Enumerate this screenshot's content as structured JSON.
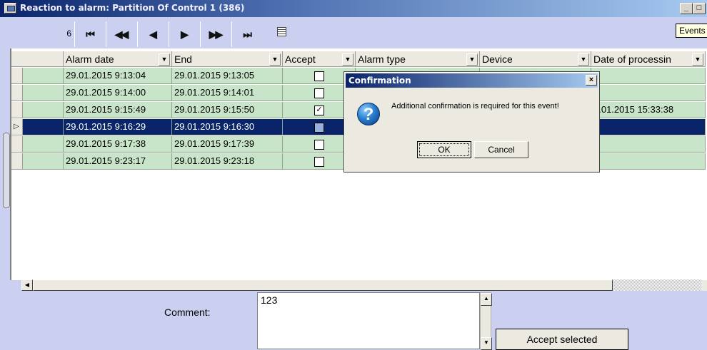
{
  "window": {
    "title": "Reaction to alarm: Partition  Of Control 1 (386)",
    "minimize_label": "_",
    "maximize_label": "□"
  },
  "navigator": {
    "record_count": "6",
    "buttons": [
      {
        "name": "first-record-button",
        "glyph": "⏮"
      },
      {
        "name": "prior-page-button",
        "glyph": "◀◀"
      },
      {
        "name": "prior-record-button",
        "glyph": "◀"
      },
      {
        "name": "next-record-button",
        "glyph": "▶"
      },
      {
        "name": "next-page-button",
        "glyph": "▶▶"
      },
      {
        "name": "last-record-button",
        "glyph": "⏭"
      }
    ],
    "tooltip": "Events"
  },
  "grid": {
    "columns": [
      "Alarm date",
      "End",
      "Accept",
      "Alarm type",
      "Device",
      "Date of processin"
    ],
    "rows": [
      {
        "alarm_date": "29.01.2015 9:13:04",
        "end": "29.01.2015 9:13:05",
        "accept": false,
        "processing": ""
      },
      {
        "alarm_date": "29.01.2015 9:14:00",
        "end": "29.01.2015 9:14:01",
        "accept": false,
        "processing": ""
      },
      {
        "alarm_date": "29.01.2015 9:15:49",
        "end": "29.01.2015 9:15:50",
        "accept": true,
        "processing": "9.01.2015 15:33:38"
      },
      {
        "alarm_date": "29.01.2015 9:16:29",
        "end": "29.01.2015 9:16:30",
        "accept": false,
        "processing": "",
        "selected": true
      },
      {
        "alarm_date": "29.01.2015 9:17:38",
        "end": "29.01.2015 9:17:39",
        "accept": false,
        "processing": ""
      },
      {
        "alarm_date": "29.01.2015 9:23:17",
        "end": "29.01.2015 9:23:18",
        "accept": false,
        "processing": ""
      }
    ],
    "row_color": "#c9e5c9",
    "selected_color": "#0a246a"
  },
  "bottom": {
    "comment_label": "Comment:",
    "comment_value": "123",
    "accept_selected_label": "Accept selected"
  },
  "dialog": {
    "title": "Confirmation",
    "message": "Additional confirmation is required for this event!",
    "icon": "question-icon",
    "ok_label": "OK",
    "cancel_label": "Cancel",
    "close_label": "×"
  }
}
